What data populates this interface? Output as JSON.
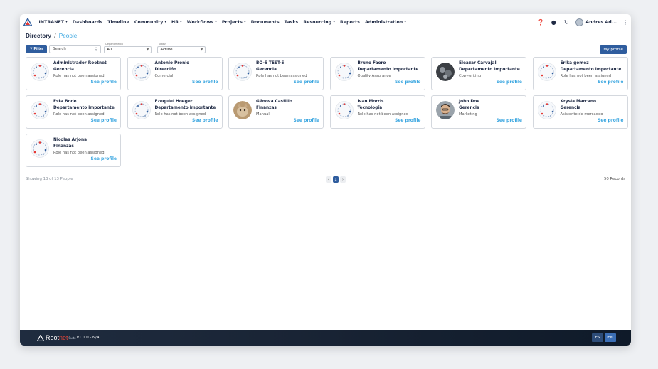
{
  "nav": {
    "items": [
      {
        "label": "INTRANET",
        "dropdown": true
      },
      {
        "label": "Dashboards",
        "dropdown": false
      },
      {
        "label": "Timeline",
        "dropdown": false
      },
      {
        "label": "Community",
        "dropdown": true,
        "active": true
      },
      {
        "label": "HR",
        "dropdown": true
      },
      {
        "label": "Workflows",
        "dropdown": true
      },
      {
        "label": "Projects",
        "dropdown": true
      },
      {
        "label": "Documents",
        "dropdown": false
      },
      {
        "label": "Tasks",
        "dropdown": false
      },
      {
        "label": "Resourcing",
        "dropdown": true
      },
      {
        "label": "Reports",
        "dropdown": false
      },
      {
        "label": "Administration",
        "dropdown": true
      }
    ],
    "icons": [
      "help-icon",
      "bell-icon",
      "refresh-icon"
    ],
    "user_name": "Andres Ad..."
  },
  "breadcrumb": {
    "root": "Directory",
    "separator": "/",
    "current": "People"
  },
  "filters": {
    "filter_label": "Filter",
    "search_placeholder": "Search",
    "department_caption": "Departamento",
    "department_value": "All",
    "status_caption": "Status",
    "status_value": "Active",
    "my_profile_label": "My profile"
  },
  "people": [
    {
      "name": "Administrador Rootnet",
      "dept": "Gerencia",
      "role": "Role has not been assigned",
      "avatar": "placeholder"
    },
    {
      "name": "Antonio Pronio",
      "dept": "Dirección",
      "role": "Comercial",
      "avatar": "placeholder"
    },
    {
      "name": "BO-5 TEST-5",
      "dept": "Gerencia",
      "role": "Role has not been assigned",
      "avatar": "placeholder"
    },
    {
      "name": "Bruno Faoro",
      "dept": "Departamento importante",
      "role": "Quality Assurance",
      "avatar": "placeholder"
    },
    {
      "name": "Eleazar Carvajal",
      "dept": "Departamento importante",
      "role": "Copywriting",
      "avatar": "photo-dark"
    },
    {
      "name": "Erika gomez",
      "dept": "Departamento importante",
      "role": "Role has not been assigned",
      "avatar": "placeholder"
    },
    {
      "name": "Esta Bode",
      "dept": "Departamento importante",
      "role": "Role has not been assigned",
      "avatar": "placeholder"
    },
    {
      "name": "Ezequiel Hoeger",
      "dept": "Departamento importante",
      "role": "Role has not been assigned",
      "avatar": "placeholder"
    },
    {
      "name": "Génova Castillo",
      "dept": "Finanzas",
      "role": "Manual",
      "avatar": "photo-cat"
    },
    {
      "name": "Ivan Morris",
      "dept": "Tecnología",
      "role": "Role has not been assigned",
      "avatar": "placeholder"
    },
    {
      "name": "John Doe",
      "dept": "Gerencia",
      "role": "Marketing",
      "avatar": "photo-man"
    },
    {
      "name": "Krysla Marcano",
      "dept": "Gerencia",
      "role": "Asistente de mercadeo",
      "avatar": "placeholder"
    },
    {
      "name": "Nicolas Arjona",
      "dept": "Finanzas",
      "role": "Role has not been assigned",
      "avatar": "placeholder"
    }
  ],
  "see_profile_label": "See profile",
  "footer": {
    "showing": "Showing 13 of 13 People",
    "page_prev": "‹",
    "page_current": "1",
    "page_next": "›",
    "records": "50 Records"
  },
  "bottombar": {
    "brand_root": "Root",
    "brand_net": "net",
    "brand_suite": "Suite",
    "version": "v1.0.0 - N/A",
    "languages": [
      "ES",
      "EN"
    ]
  },
  "colors": {
    "primary": "#2f5d9e",
    "link": "#3aa6e0",
    "accent_red": "#e53935",
    "text_dark": "#1f2a44"
  }
}
